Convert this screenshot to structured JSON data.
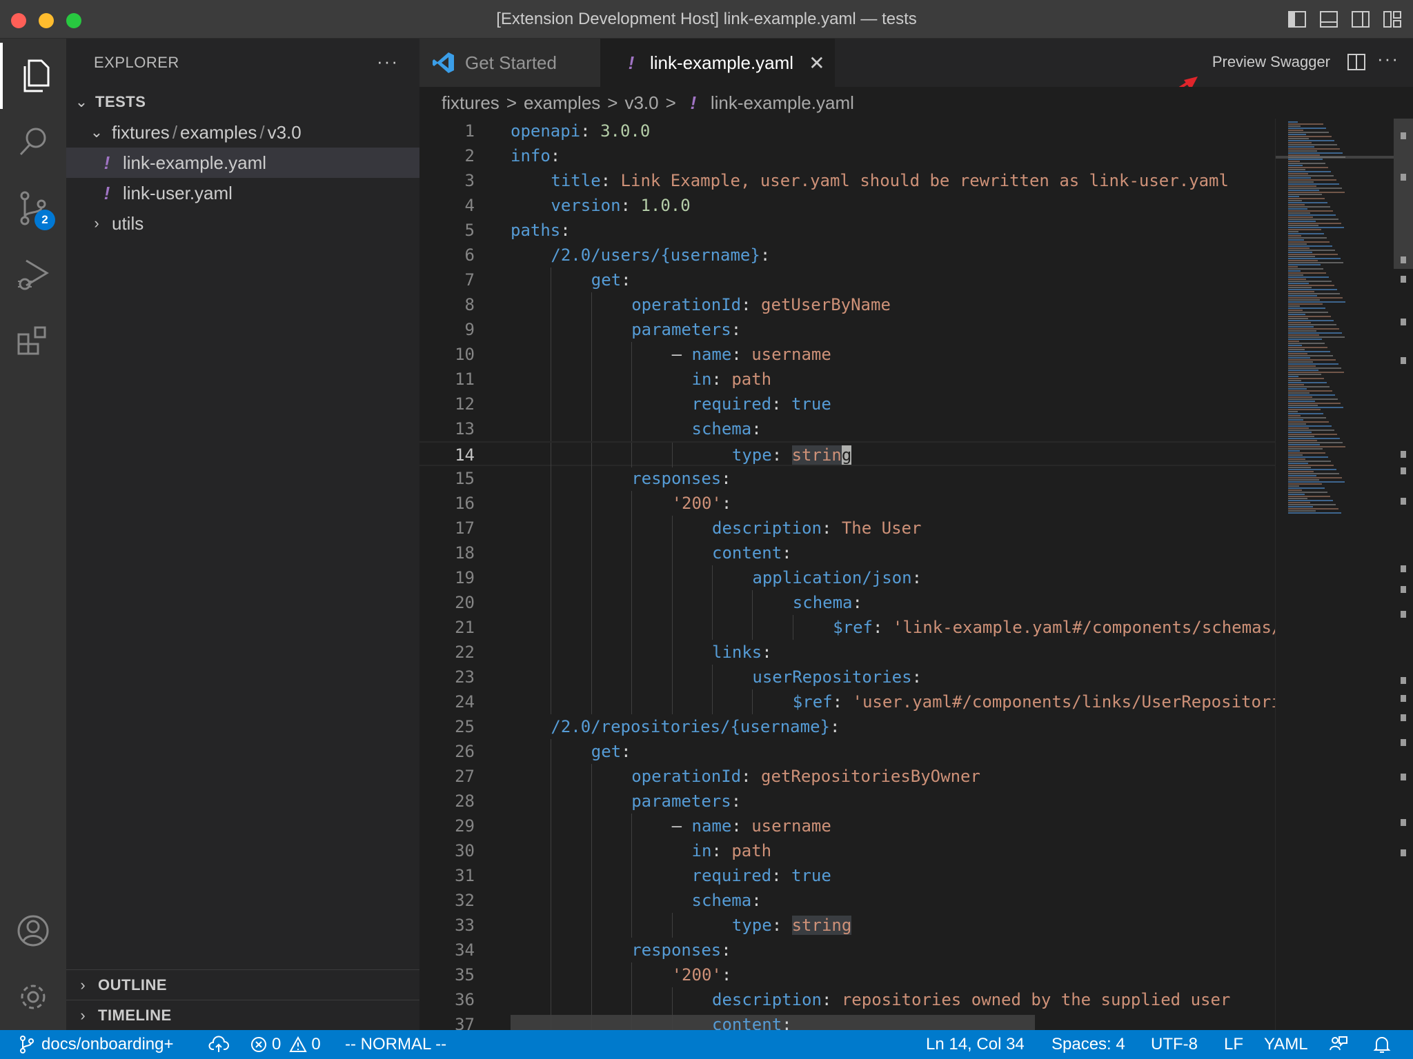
{
  "window": {
    "title": "[Extension Development Host] link-example.yaml — tests"
  },
  "activity_bar": {
    "scm_badge": "2"
  },
  "sidebar": {
    "header": "EXPLORER",
    "more": "···",
    "root": "TESTS",
    "folder_parts": [
      "fixtures",
      "/",
      "examples",
      "/",
      "v3.0"
    ],
    "files": [
      {
        "icon": "!",
        "name": "link-example.yaml"
      },
      {
        "icon": "!",
        "name": "link-user.yaml"
      }
    ],
    "utils_folder": "utils",
    "outline": "OUTLINE",
    "timeline": "TIMELINE"
  },
  "tabs": {
    "get_started": "Get Started",
    "active_icon": "!",
    "active": "link-example.yaml",
    "close": "✕",
    "preview_swagger": "Preview Swagger",
    "more": "···"
  },
  "breadcrumb": {
    "parts": [
      "fixtures",
      "examples",
      "v3.0"
    ],
    "separator": ">",
    "icon": "!",
    "file": "link-example.yaml"
  },
  "editor": {
    "current_line": 14,
    "lines": [
      {
        "n": "1",
        "indent": 0,
        "segs": [
          [
            "k",
            "openapi"
          ],
          [
            "p",
            ": "
          ],
          [
            "n",
            "3.0.0"
          ]
        ]
      },
      {
        "n": "2",
        "indent": 0,
        "segs": [
          [
            "k",
            "info"
          ],
          [
            "p",
            ":"
          ]
        ]
      },
      {
        "n": "3",
        "indent": 1,
        "segs": [
          [
            "k",
            "title"
          ],
          [
            "p",
            ": "
          ],
          [
            "s",
            "Link Example, user.yaml should be rewritten as link-user.yaml"
          ]
        ]
      },
      {
        "n": "4",
        "indent": 1,
        "segs": [
          [
            "k",
            "version"
          ],
          [
            "p",
            ": "
          ],
          [
            "n",
            "1.0.0"
          ]
        ]
      },
      {
        "n": "5",
        "indent": 0,
        "segs": [
          [
            "k",
            "paths"
          ],
          [
            "p",
            ":"
          ]
        ]
      },
      {
        "n": "6",
        "indent": 1,
        "segs": [
          [
            "k",
            "/2.0/users/{username}"
          ],
          [
            "p",
            ":"
          ]
        ]
      },
      {
        "n": "7",
        "indent": 2,
        "segs": [
          [
            "k",
            "get"
          ],
          [
            "p",
            ":"
          ]
        ]
      },
      {
        "n": "8",
        "indent": 3,
        "segs": [
          [
            "k",
            "operationId"
          ],
          [
            "p",
            ": "
          ],
          [
            "s",
            "getUserByName"
          ]
        ]
      },
      {
        "n": "9",
        "indent": 3,
        "segs": [
          [
            "k",
            "parameters"
          ],
          [
            "p",
            ":"
          ]
        ]
      },
      {
        "n": "10",
        "indent": 4,
        "segs": [
          [
            "p",
            "– "
          ],
          [
            "k",
            "name"
          ],
          [
            "p",
            ": "
          ],
          [
            "s",
            "username"
          ]
        ]
      },
      {
        "n": "11",
        "indent": 4,
        "segs": [
          [
            "p",
            "  "
          ],
          [
            "k",
            "in"
          ],
          [
            "p",
            ": "
          ],
          [
            "s",
            "path"
          ]
        ]
      },
      {
        "n": "12",
        "indent": 4,
        "segs": [
          [
            "p",
            "  "
          ],
          [
            "k",
            "required"
          ],
          [
            "p",
            ": "
          ],
          [
            "k",
            "true"
          ]
        ]
      },
      {
        "n": "13",
        "indent": 4,
        "segs": [
          [
            "p",
            "  "
          ],
          [
            "k",
            "schema"
          ],
          [
            "p",
            ":"
          ]
        ]
      },
      {
        "n": "14",
        "indent": 5,
        "segs": [
          [
            "p",
            "  "
          ],
          [
            "k",
            "type"
          ],
          [
            "p",
            ": "
          ],
          [
            "hl",
            "strin"
          ],
          [
            "caret",
            "g"
          ]
        ]
      },
      {
        "n": "15",
        "indent": 3,
        "segs": [
          [
            "k",
            "responses"
          ],
          [
            "p",
            ":"
          ]
        ]
      },
      {
        "n": "16",
        "indent": 4,
        "segs": [
          [
            "s",
            "'200'"
          ],
          [
            "p",
            ":"
          ]
        ]
      },
      {
        "n": "17",
        "indent": 5,
        "segs": [
          [
            "k",
            "description"
          ],
          [
            "p",
            ": "
          ],
          [
            "s",
            "The User"
          ]
        ]
      },
      {
        "n": "18",
        "indent": 5,
        "segs": [
          [
            "k",
            "content"
          ],
          [
            "p",
            ":"
          ]
        ]
      },
      {
        "n": "19",
        "indent": 6,
        "segs": [
          [
            "k",
            "application/json"
          ],
          [
            "p",
            ":"
          ]
        ]
      },
      {
        "n": "20",
        "indent": 7,
        "segs": [
          [
            "k",
            "schema"
          ],
          [
            "p",
            ":"
          ]
        ]
      },
      {
        "n": "21",
        "indent": 8,
        "segs": [
          [
            "k",
            "$ref"
          ],
          [
            "p",
            ": "
          ],
          [
            "s",
            "'link-example.yaml#/components/schemas/"
          ]
        ]
      },
      {
        "n": "22",
        "indent": 5,
        "segs": [
          [
            "k",
            "links"
          ],
          [
            "p",
            ":"
          ]
        ]
      },
      {
        "n": "23",
        "indent": 6,
        "segs": [
          [
            "k",
            "userRepositories"
          ],
          [
            "p",
            ":"
          ]
        ]
      },
      {
        "n": "24",
        "indent": 7,
        "segs": [
          [
            "k",
            "$ref"
          ],
          [
            "p",
            ": "
          ],
          [
            "s",
            "'user.yaml#/components/links/UserRepositori"
          ]
        ]
      },
      {
        "n": "25",
        "indent": 1,
        "segs": [
          [
            "k",
            "/2.0/repositories/{username}"
          ],
          [
            "p",
            ":"
          ]
        ]
      },
      {
        "n": "26",
        "indent": 2,
        "segs": [
          [
            "k",
            "get"
          ],
          [
            "p",
            ":"
          ]
        ]
      },
      {
        "n": "27",
        "indent": 3,
        "segs": [
          [
            "k",
            "operationId"
          ],
          [
            "p",
            ": "
          ],
          [
            "s",
            "getRepositoriesByOwner"
          ]
        ]
      },
      {
        "n": "28",
        "indent": 3,
        "segs": [
          [
            "k",
            "parameters"
          ],
          [
            "p",
            ":"
          ]
        ]
      },
      {
        "n": "29",
        "indent": 4,
        "segs": [
          [
            "p",
            "– "
          ],
          [
            "k",
            "name"
          ],
          [
            "p",
            ": "
          ],
          [
            "s",
            "username"
          ]
        ]
      },
      {
        "n": "30",
        "indent": 4,
        "segs": [
          [
            "p",
            "  "
          ],
          [
            "k",
            "in"
          ],
          [
            "p",
            ": "
          ],
          [
            "s",
            "path"
          ]
        ]
      },
      {
        "n": "31",
        "indent": 4,
        "segs": [
          [
            "p",
            "  "
          ],
          [
            "k",
            "required"
          ],
          [
            "p",
            ": "
          ],
          [
            "k",
            "true"
          ]
        ]
      },
      {
        "n": "32",
        "indent": 4,
        "segs": [
          [
            "p",
            "  "
          ],
          [
            "k",
            "schema"
          ],
          [
            "p",
            ":"
          ]
        ]
      },
      {
        "n": "33",
        "indent": 5,
        "segs": [
          [
            "p",
            "  "
          ],
          [
            "k",
            "type"
          ],
          [
            "p",
            ": "
          ],
          [
            "hl",
            "string"
          ]
        ]
      },
      {
        "n": "34",
        "indent": 3,
        "segs": [
          [
            "k",
            "responses"
          ],
          [
            "p",
            ":"
          ]
        ]
      },
      {
        "n": "35",
        "indent": 4,
        "segs": [
          [
            "s",
            "'200'"
          ],
          [
            "p",
            ":"
          ]
        ]
      },
      {
        "n": "36",
        "indent": 5,
        "segs": [
          [
            "k",
            "description"
          ],
          [
            "p",
            ": "
          ],
          [
            "s",
            "repositories owned by the supplied user"
          ]
        ]
      },
      {
        "n": "37",
        "indent": 5,
        "segs": [
          [
            "k",
            "content"
          ],
          [
            "p",
            ":"
          ]
        ]
      }
    ]
  },
  "statusbar": {
    "branch": "docs/onboarding+",
    "errors": "0",
    "warnings": "0",
    "mode": "-- NORMAL --",
    "position": "Ln 14, Col 34",
    "spaces": "Spaces: 4",
    "encoding": "UTF-8",
    "eol": "LF",
    "language": "YAML"
  },
  "colors": {
    "keyword": "#569cd6",
    "string": "#ce9178",
    "number": "#b5cea8",
    "status_bar": "#007acc",
    "annotation_arrow": "#e0252b"
  }
}
